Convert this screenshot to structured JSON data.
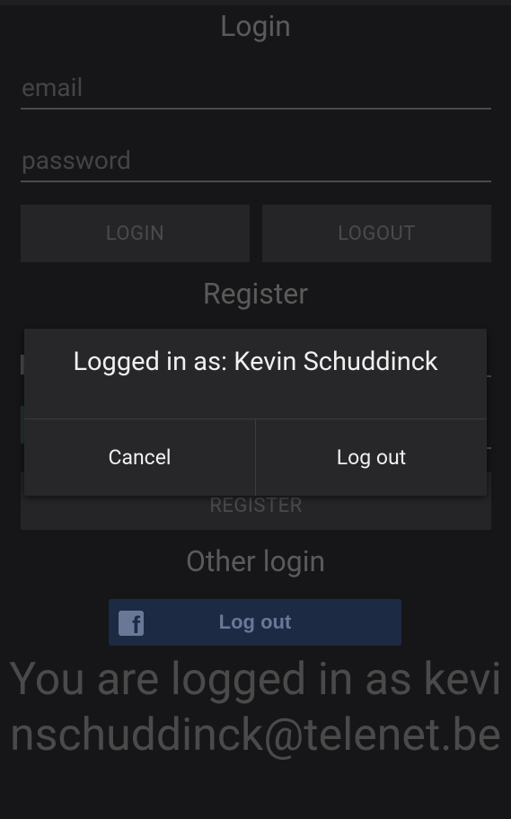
{
  "login_section": {
    "title": "Login",
    "email_placeholder": "email",
    "password_placeholder": "password",
    "login_button": "LOGIN",
    "logout_button": "LOGOUT"
  },
  "register_section": {
    "title": "Register",
    "register_button": "REGISTER"
  },
  "other_login": {
    "title": "Other login",
    "facebook_button_label": "Log out",
    "facebook_icon": "facebook-f-icon"
  },
  "status_text": "You are logged in as kevinschuddinck@telenet.be",
  "dialog": {
    "message": "Logged in as: Kevin Schuddinck",
    "cancel_label": "Cancel",
    "logout_label": "Log out"
  },
  "colors": {
    "background": "#161618",
    "dialog_background": "#272729",
    "facebook_button": "#1d2a44"
  }
}
